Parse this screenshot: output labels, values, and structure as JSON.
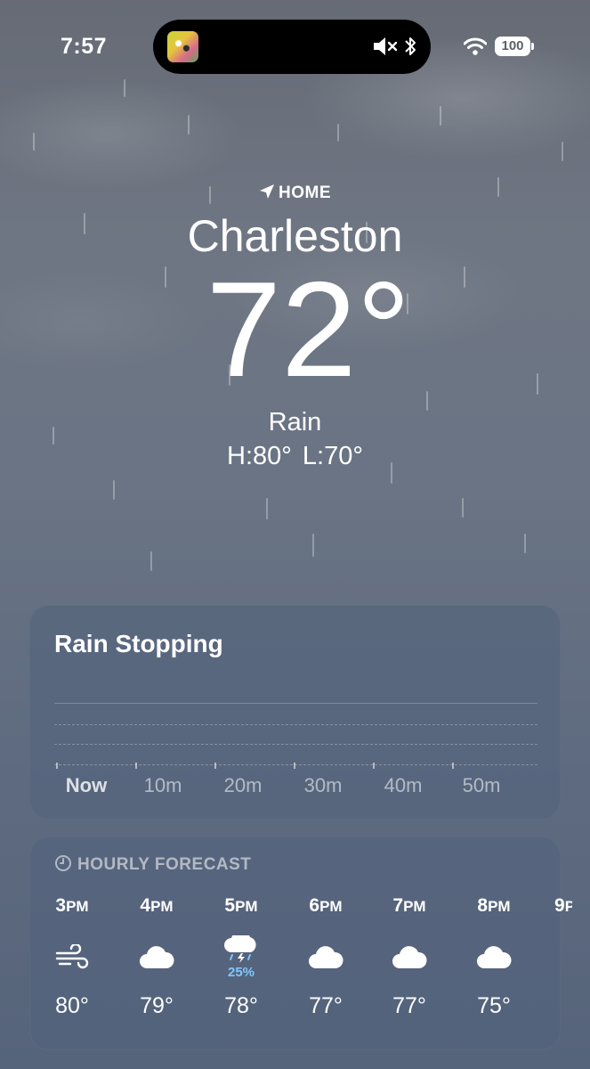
{
  "status_bar": {
    "time": "7:57",
    "battery": "100"
  },
  "header": {
    "location_label": "HOME",
    "city": "Charleston",
    "temperature": "72°",
    "condition": "Rain",
    "high": "H:80°",
    "low": "L:70°"
  },
  "precip_card": {
    "title": "Rain Stopping",
    "ticks": [
      "Now",
      "10m",
      "20m",
      "30m",
      "40m",
      "50m"
    ]
  },
  "hourly_card": {
    "title": "HOURLY FORECAST",
    "hours": [
      {
        "hour": "3",
        "suffix": "PM",
        "icon": "wind-icon",
        "temp": "80°"
      },
      {
        "hour": "4",
        "suffix": "PM",
        "icon": "cloud-icon",
        "temp": "79°"
      },
      {
        "hour": "5",
        "suffix": "PM",
        "icon": "thunderstorm-icon",
        "precip": "25%",
        "temp": "78°"
      },
      {
        "hour": "6",
        "suffix": "PM",
        "icon": "cloud-icon",
        "temp": "77°"
      },
      {
        "hour": "7",
        "suffix": "PM",
        "icon": "cloud-icon",
        "temp": "77°"
      },
      {
        "hour": "8",
        "suffix": "PM",
        "icon": "cloud-icon",
        "temp": "75°"
      },
      {
        "hour": "9",
        "suffix": "PM"
      }
    ]
  },
  "colors": {
    "precip_blue": "#7fc8ff",
    "card_bg": "#52627c"
  }
}
